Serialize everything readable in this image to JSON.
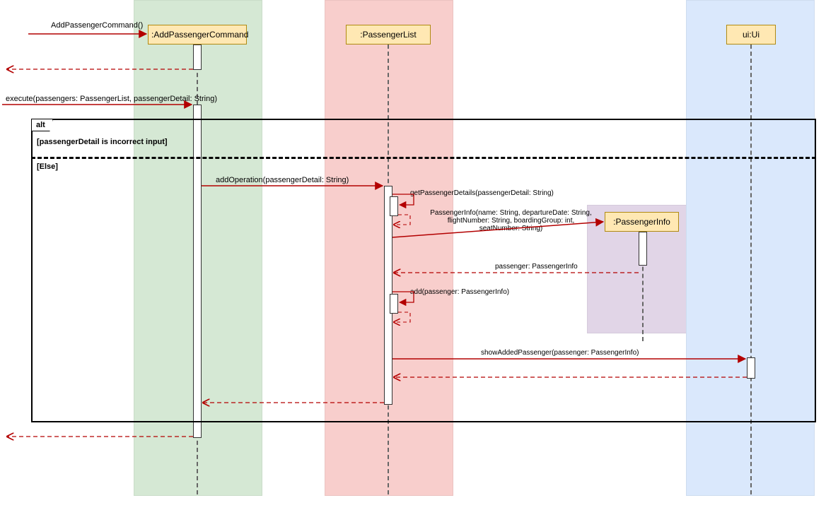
{
  "diagram": {
    "type": "UML Sequence Diagram",
    "alt": {
      "tag": "alt",
      "guard1": "[passengerDetail is incorrect input]",
      "guard2": "[Else]"
    },
    "lifelines": {
      "addCmd": ":AddPassengerCommand",
      "passengerList": ":PassengerList",
      "passengerInfo": ":PassengerInfo",
      "ui": "ui:Ui"
    },
    "messages": {
      "createCmd": "AddPassengerCommand()",
      "execute": "execute(passengers: PassengerList, passengerDetail: String)",
      "addOperation": "addOperation(passengerDetail: String)",
      "getPassengerDetails": "getPassengerDetails(passengerDetail: String)",
      "ctorPassengerInfo": "PassengerInfo(name: String, departureDate: String, flightNumber: String, boardingGroup: int, seatNumber: String)",
      "returnPassenger": "passenger: PassengerInfo",
      "addPassenger": "add(passenger: PassengerInfo)",
      "showAdded": "showAddedPassenger(passenger: PassengerInfo)"
    }
  }
}
